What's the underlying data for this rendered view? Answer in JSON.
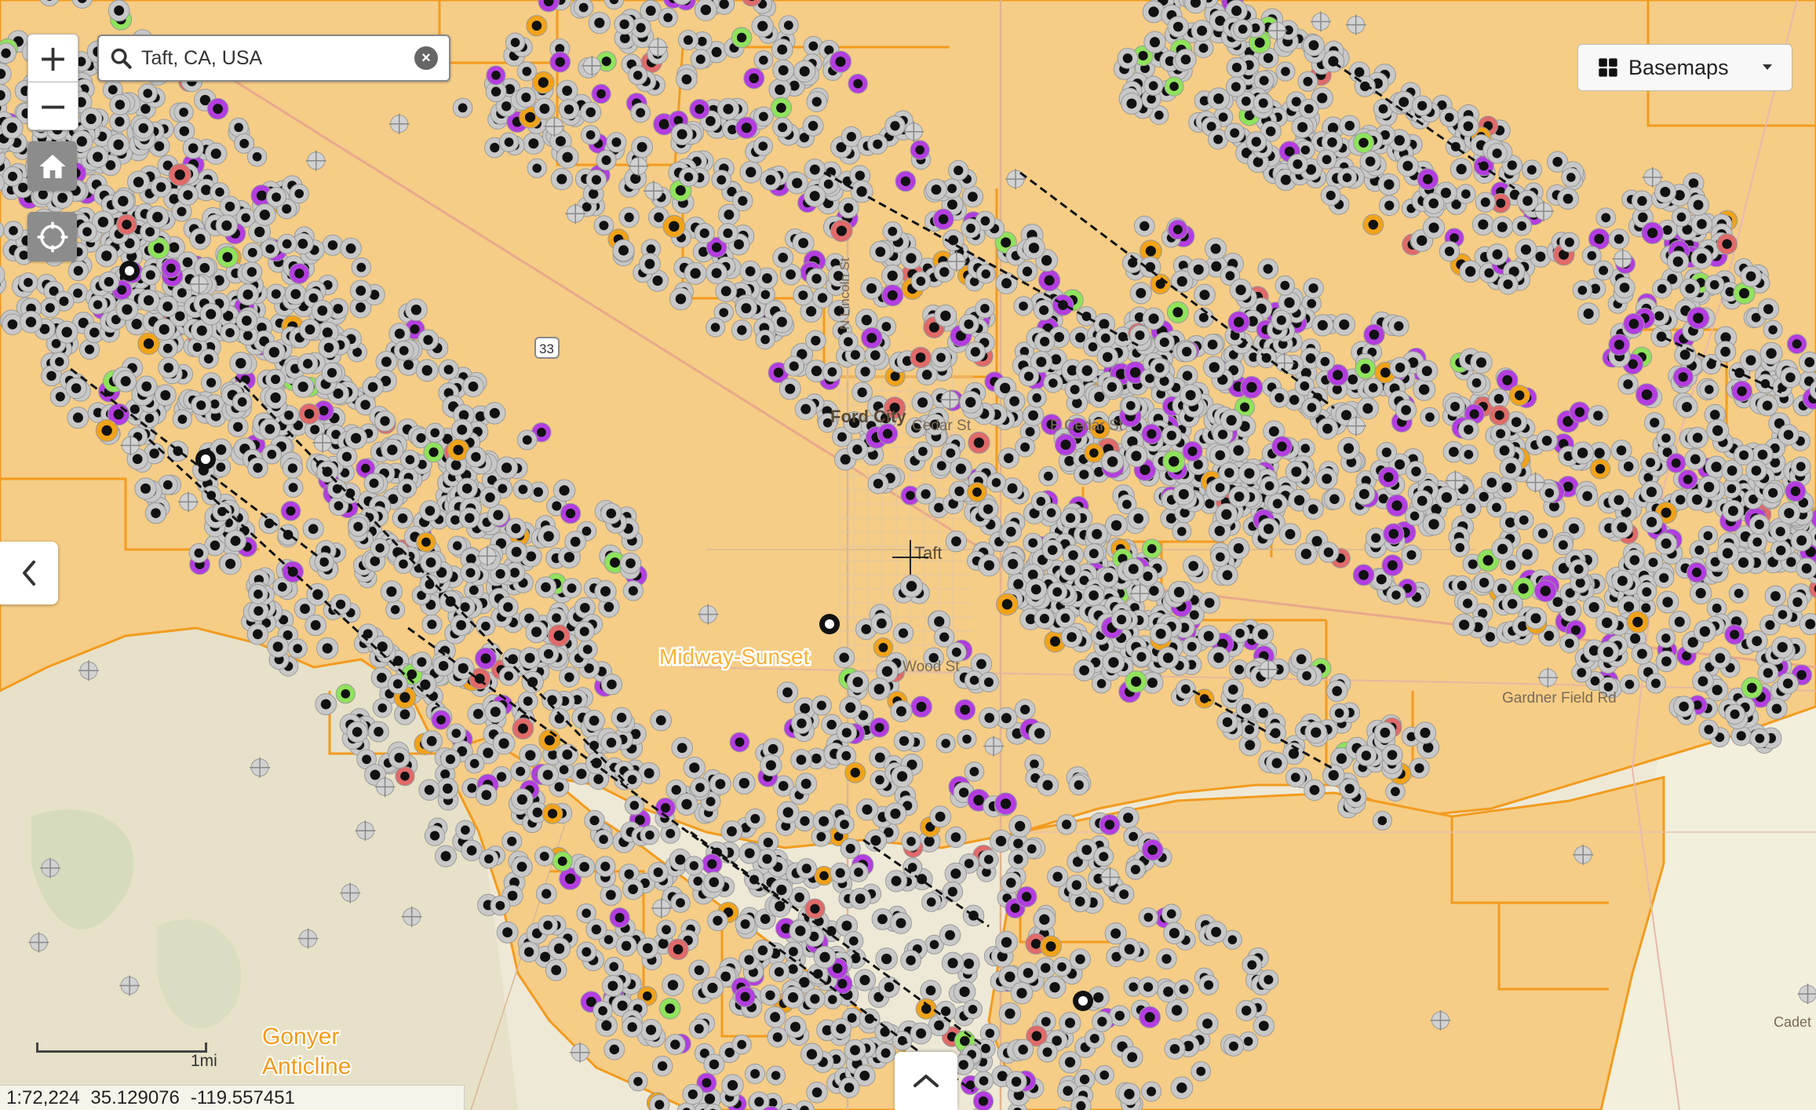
{
  "search": {
    "value": "Taft, CA, USA",
    "clear_icon": "close-circle-icon",
    "search_icon": "search-icon"
  },
  "zoom": {
    "in_label": "+",
    "out_label": "−"
  },
  "nav": {
    "home_icon": "home-icon",
    "locate_icon": "crosshair-locate-icon"
  },
  "basemaps": {
    "label": "Basemaps",
    "icon": "grid-icon",
    "dropdown_icon": "caret-down-icon"
  },
  "panels": {
    "left_toggle_icon": "chevron-left-icon",
    "bottom_toggle_icon": "chevron-up-icon"
  },
  "scale": {
    "label": "1mi"
  },
  "status": {
    "scale": "1:72,224",
    "lat": "35.129076",
    "lon": "-119.557451"
  },
  "map": {
    "labels": {
      "place_ford_city": "Ford City",
      "place_taft": "Taft",
      "place_maricopa": "Midway-Sunset",
      "feature_gonyer_1": "Gonyer",
      "feature_gonyer_2": "Anticline",
      "street_cedar_w": "Cedar St",
      "street_cedar_e": "E Cedar St",
      "street_wood": "Wood St",
      "street_gardner": "Gardner Field Rd",
      "street_cadet": "Cadet Rd",
      "street_lincoln": "N Lincoln St",
      "highway_33": "33"
    },
    "colors": {
      "field_area": "#f5cd86",
      "field_border": "#f29b1f",
      "hills": "#e3dfc9",
      "well_active": "#111111",
      "well_ring": "#c8c8c8",
      "well_injection": "#b33de0",
      "well_new": "#8fe35c",
      "well_idle": "#f0a31a",
      "well_plugged": "#e06a6a"
    }
  }
}
